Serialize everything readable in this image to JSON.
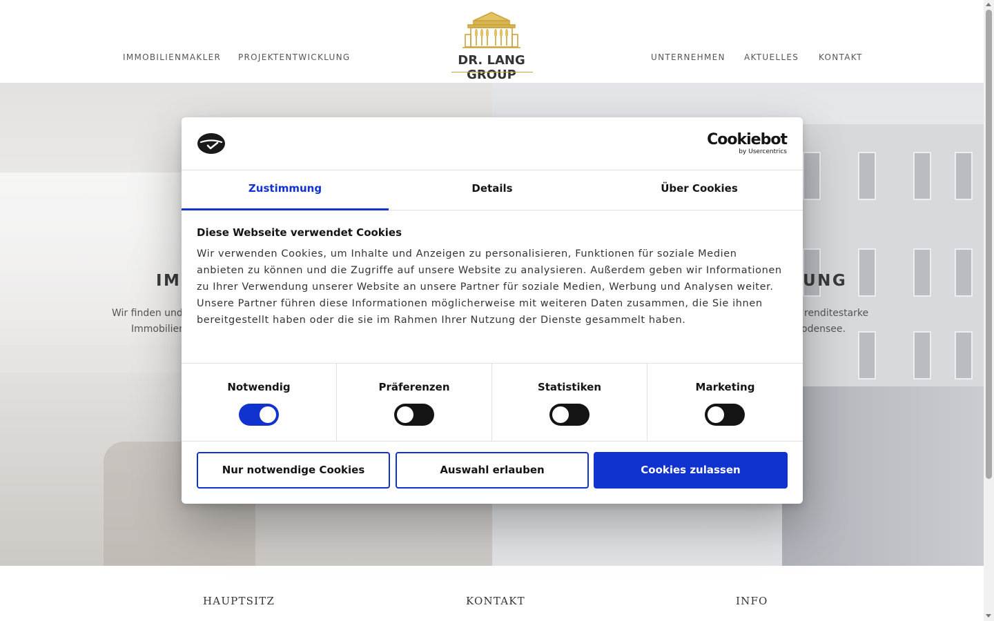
{
  "header": {
    "nav_left": [
      "IMMOBILIENMAKLER",
      "PROJEKTENTWICKLUNG"
    ],
    "nav_right": [
      "UNTERNEHMEN",
      "AKTUELLES",
      "KONTAKT"
    ],
    "logo_text": "DR. LANG GROUP"
  },
  "hero": {
    "left_title_visible": "IMI",
    "left_text_line1": "Wir finden und",
    "left_text_line2": "Immobilien",
    "right_title_visible": "UNG",
    "right_text_line1": "renditestarke",
    "right_text_line2": "odensee."
  },
  "footer": {
    "headings": [
      "HAUPTSITZ",
      "KONTAKT",
      "INFO"
    ]
  },
  "cookie_dialog": {
    "brand_name": "Cookiebot",
    "brand_sub": "by Usercentrics",
    "tabs": [
      "Zustimmung",
      "Details",
      "Über Cookies"
    ],
    "active_tab": 0,
    "title": "Diese Webseite verwendet Cookies",
    "text": "Wir verwenden Cookies, um Inhalte und Anzeigen zu personalisieren, Funktionen für soziale Medien anbieten zu können und die Zugriffe auf unsere Website zu analysieren. Außerdem geben wir Informationen zu Ihrer Verwendung unserer Website an unsere Partner für soziale Medien, Werbung und Analysen weiter. Unsere Partner führen diese Informationen möglicherweise mit weiteren Daten zusammen, die Sie ihnen bereitgestellt haben oder die sie im Rahmen Ihrer Nutzung der Dienste gesammelt haben.",
    "consents": [
      {
        "label": "Notwendig",
        "enabled": true
      },
      {
        "label": "Präferenzen",
        "enabled": false
      },
      {
        "label": "Statistiken",
        "enabled": false
      },
      {
        "label": "Marketing",
        "enabled": false
      }
    ],
    "buttons": {
      "necessary_only": "Nur notwendige Cookies",
      "allow_selection": "Auswahl erlauben",
      "allow_all": "Cookies zulassen"
    },
    "accent_color": "#1032cf"
  },
  "colors": {
    "logo_gold": "#c9a43a",
    "text_dark": "#141414"
  }
}
